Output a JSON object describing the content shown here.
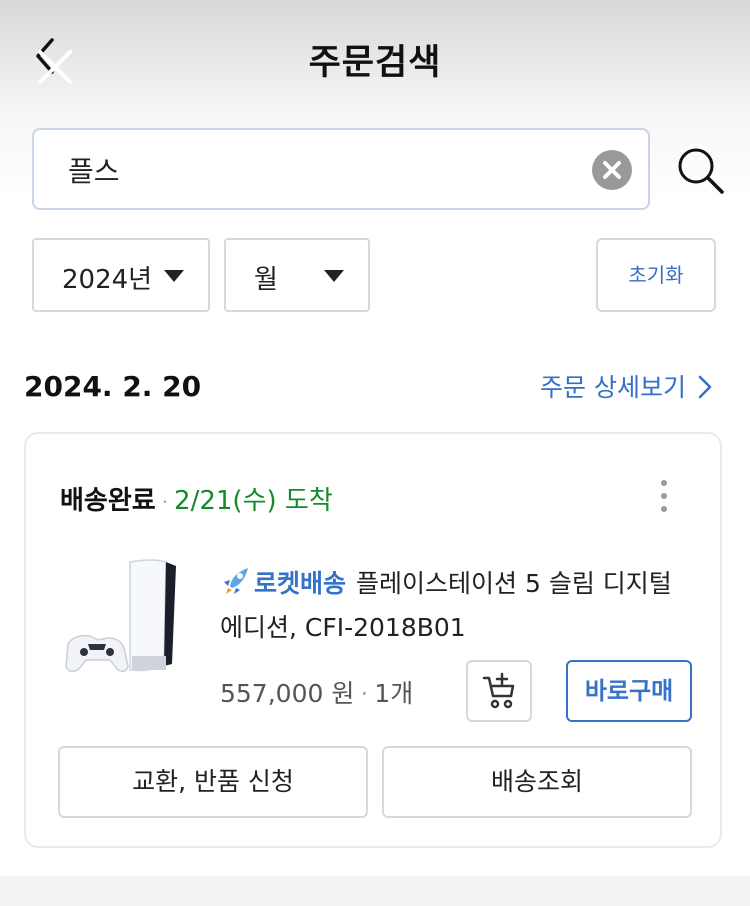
{
  "header": {
    "title": "주문검색",
    "back_icon": "back-arrow-icon"
  },
  "search": {
    "value": "플스",
    "placeholder": "",
    "clear_icon": "clear-circle-icon",
    "search_icon": "search-icon"
  },
  "filters": {
    "year_label": "2024년",
    "month_label": "월",
    "reset_label": "초기화"
  },
  "order": {
    "date": "2024. 2. 20",
    "detail_link": "주문 상세보기",
    "status": "배송완료",
    "arrival": "2/21(수) 도착",
    "rocket_label": "로켓배송",
    "product_name": "플레이스테이션 5 슬림 디지털 에디션, CFI-2018B01",
    "price": "557,000 원",
    "quantity": "1개",
    "buy_now_label": "바로구매",
    "exchange_label": "교환, 반품 신청",
    "tracking_label": "배송조회"
  },
  "colors": {
    "accent": "#3572c9",
    "arrival_green": "#168a2a"
  }
}
